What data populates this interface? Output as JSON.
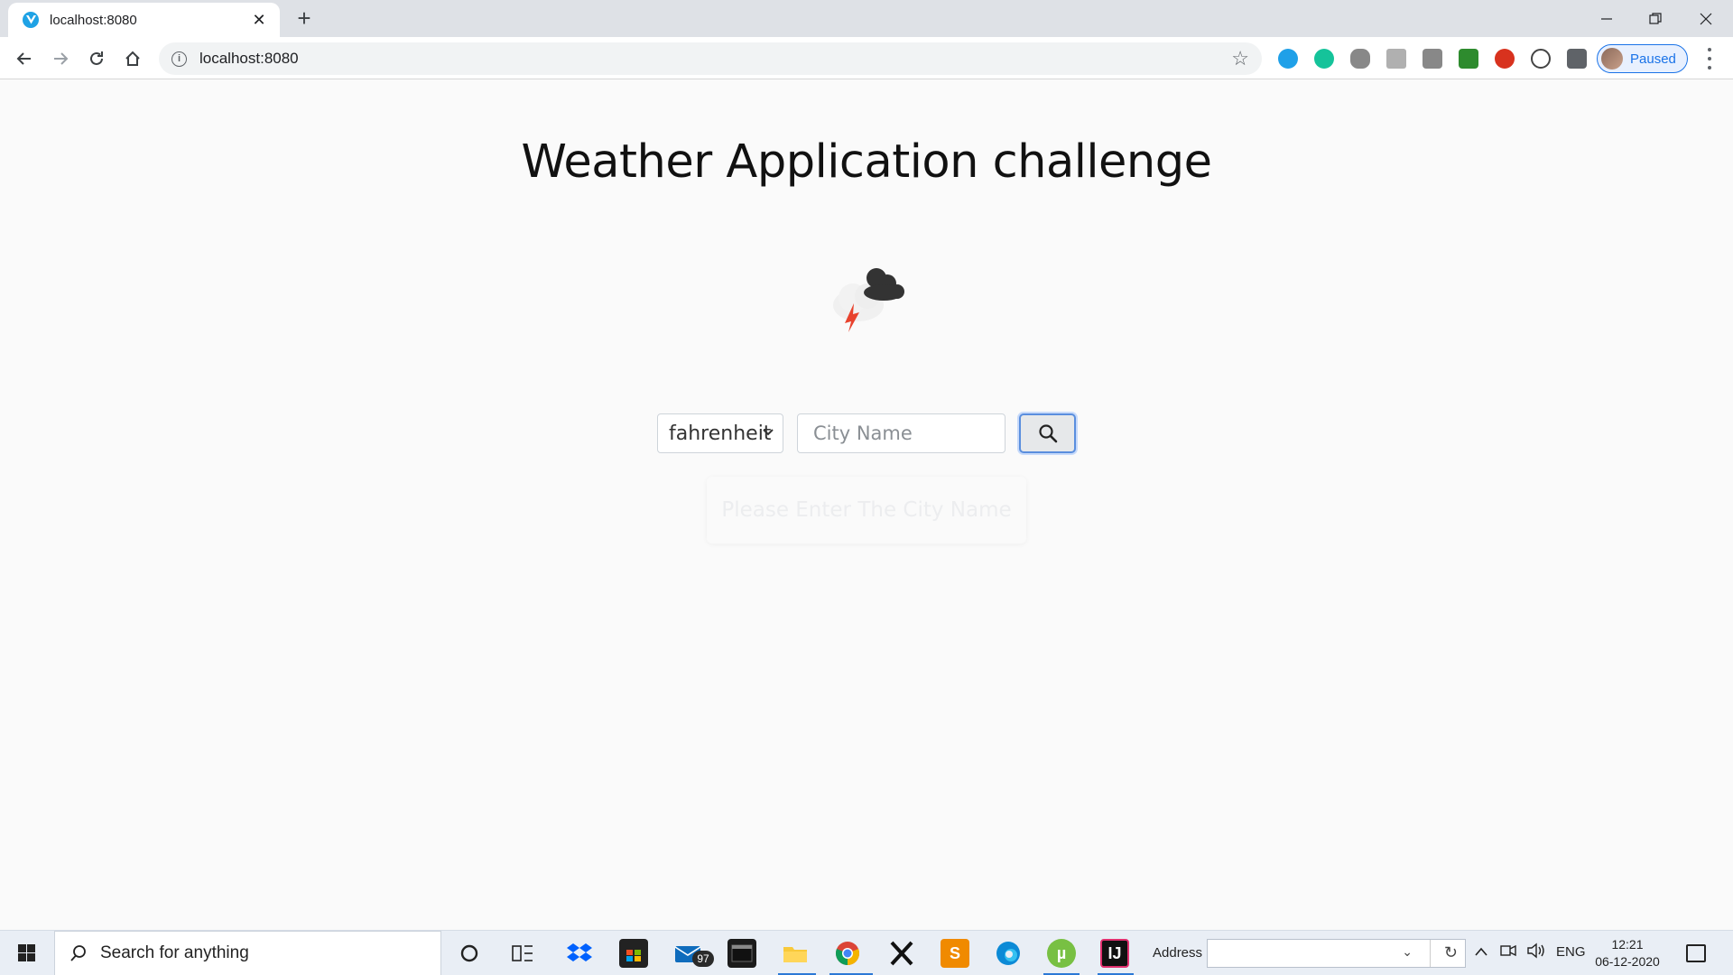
{
  "browser": {
    "tab_title": "localhost:8080",
    "url": "localhost:8080",
    "profile_status": "Paused"
  },
  "page": {
    "title": "Weather Application challenge",
    "unit_select": {
      "selected": "fahrenheit",
      "options": [
        "fahrenheit"
      ]
    },
    "city_input": {
      "value": "",
      "placeholder": "City Name"
    },
    "hint": "Please Enter The City Name"
  },
  "taskbar": {
    "search_placeholder": "Search for anything",
    "mail_badge": "97",
    "address_label": "Address",
    "language": "ENG",
    "time": "12:21",
    "date": "06-12-2020"
  },
  "colors": {
    "accent": "#1a73e8",
    "search_button_border": "#5a8ede",
    "lightning": "#e8432e",
    "cloud_dark": "#333333"
  }
}
